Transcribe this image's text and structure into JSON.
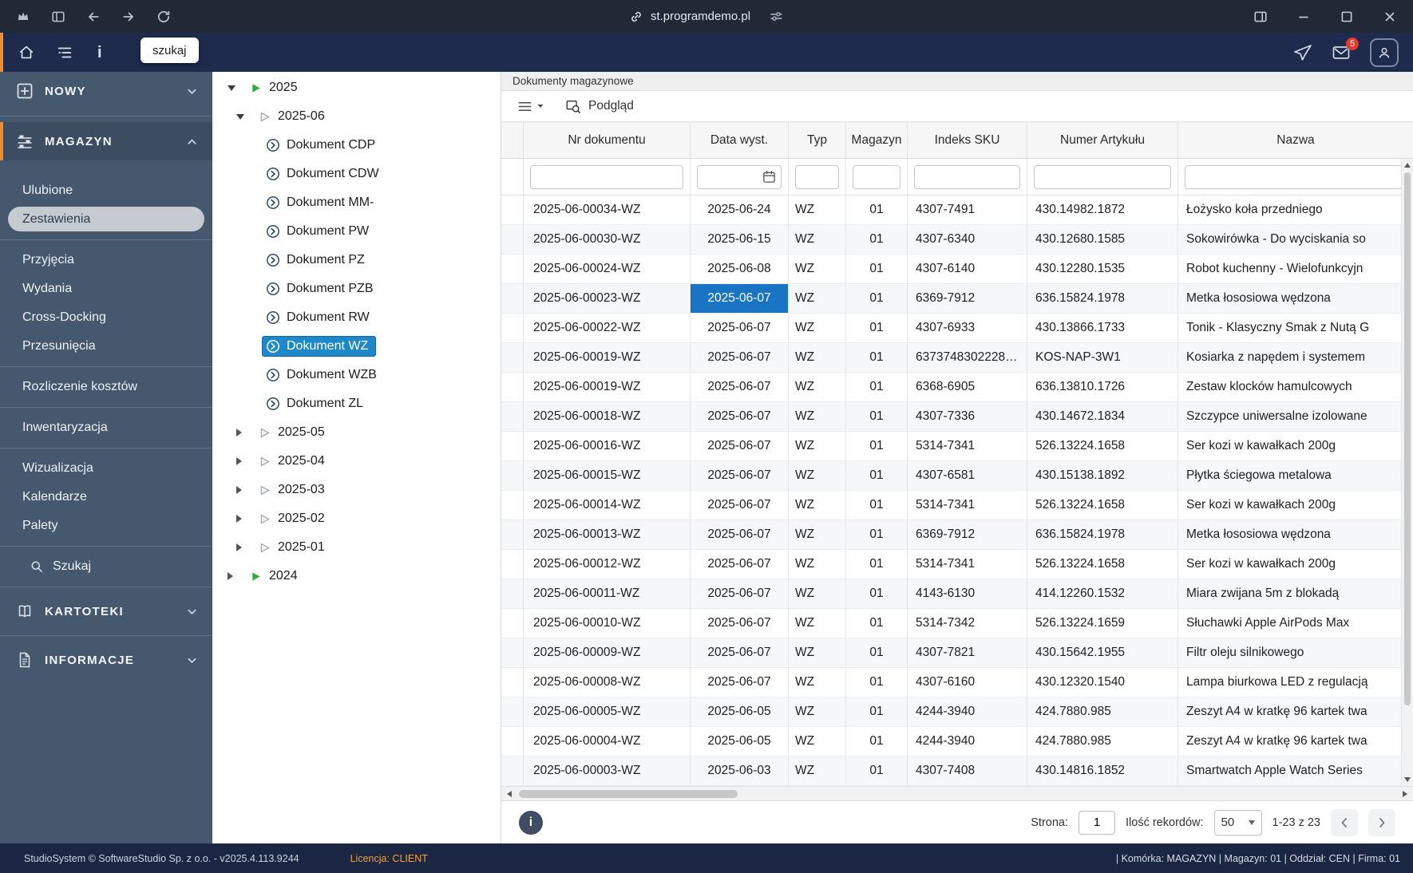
{
  "browser": {
    "url": "st.programdemo.pl"
  },
  "app_header": {
    "search_tooltip": "szukaj",
    "mail_badge": "5"
  },
  "sidebar": {
    "sections": [
      {
        "label": "NOWY",
        "state": "collapsed"
      },
      {
        "label": "MAGAZYN",
        "state": "expanded"
      },
      {
        "label": "KARTOTEKI",
        "state": "collapsed"
      },
      {
        "label": "INFORMACJE",
        "state": "collapsed"
      }
    ],
    "magazyn_items": [
      {
        "label": "Ulubione"
      },
      {
        "label": "Zestawienia",
        "selected": true
      },
      {
        "label": "Przyjęcia",
        "divider_before": true
      },
      {
        "label": "Wydania"
      },
      {
        "label": "Cross-Docking"
      },
      {
        "label": "Przesunięcia"
      },
      {
        "label": "Rozliczenie kosztów",
        "divider_before": true
      },
      {
        "label": "Inwentaryzacja",
        "divider_before": true
      },
      {
        "label": "Wizualizacja",
        "divider_before": true
      },
      {
        "label": "Kalendarze"
      },
      {
        "label": "Palety"
      },
      {
        "label": "Szukaj",
        "icon": "search",
        "divider_before": true
      }
    ]
  },
  "tree": {
    "items": [
      {
        "label": "2025",
        "level": 0,
        "icon": "year",
        "expanded": true
      },
      {
        "label": "2025-06",
        "level": 1,
        "icon": "month",
        "expanded": true
      },
      {
        "label": "Dokument CDP",
        "level": 2,
        "icon": "doc"
      },
      {
        "label": "Dokument CDW",
        "level": 2,
        "icon": "doc"
      },
      {
        "label": "Dokument MM-",
        "level": 2,
        "icon": "doc"
      },
      {
        "label": "Dokument PW",
        "level": 2,
        "icon": "doc"
      },
      {
        "label": "Dokument PZ",
        "level": 2,
        "icon": "doc"
      },
      {
        "label": "Dokument PZB",
        "level": 2,
        "icon": "doc"
      },
      {
        "label": "Dokument RW",
        "level": 2,
        "icon": "doc"
      },
      {
        "label": "Dokument WZ",
        "level": 2,
        "icon": "doc",
        "selected": true
      },
      {
        "label": "Dokument WZB",
        "level": 2,
        "icon": "doc"
      },
      {
        "label": "Dokument ZL",
        "level": 2,
        "icon": "doc"
      },
      {
        "label": "2025-05",
        "level": 1,
        "icon": "month",
        "expanded": false
      },
      {
        "label": "2025-04",
        "level": 1,
        "icon": "month",
        "expanded": false
      },
      {
        "label": "2025-03",
        "level": 1,
        "icon": "month",
        "expanded": false
      },
      {
        "label": "2025-02",
        "level": 1,
        "icon": "month",
        "expanded": false
      },
      {
        "label": "2025-01",
        "level": 1,
        "icon": "month",
        "expanded": false
      },
      {
        "label": "2024",
        "level": 0,
        "icon": "year",
        "expanded": false
      }
    ]
  },
  "main": {
    "title": "Dokumenty magazynowe",
    "toolbar": {
      "preview_label": "Podgląd"
    },
    "table": {
      "columns": [
        "Nr dokumentu",
        "Data wyst.",
        "Typ",
        "Magazyn",
        "Indeks SKU",
        "Numer Artykułu",
        "Nazwa"
      ],
      "filter_values": [
        "",
        "",
        "",
        "",
        "",
        "",
        ""
      ],
      "selected_cell": {
        "row_index": 3,
        "col_index": 1
      },
      "rows": [
        [
          "2025-06-00034-WZ",
          "2025-06-24",
          "WZ",
          "01",
          "4307-7491",
          "430.14982.1872",
          "Łożysko koła przedniego"
        ],
        [
          "2025-06-00030-WZ",
          "2025-06-15",
          "WZ",
          "01",
          "4307-6340",
          "430.12680.1585",
          "Sokowirówka - Do wyciskania so"
        ],
        [
          "2025-06-00024-WZ",
          "2025-06-08",
          "WZ",
          "01",
          "4307-6140",
          "430.12280.1535",
          "Robot kuchenny - Wielofunkcyjn"
        ],
        [
          "2025-06-00023-WZ",
          "2025-06-07",
          "WZ",
          "01",
          "6369-7912",
          "636.15824.1978",
          "Metka łososiowa wędzona"
        ],
        [
          "2025-06-00022-WZ",
          "2025-06-07",
          "WZ",
          "01",
          "4307-6933",
          "430.13866.1733",
          "Tonik - Klasyczny Smak z Nutą G"
        ],
        [
          "2025-06-00019-WZ",
          "2025-06-07",
          "WZ",
          "01",
          "6373748302228…",
          "KOS-NAP-3W1",
          "Kosiarka z napędem i systemem"
        ],
        [
          "2025-06-00019-WZ",
          "2025-06-07",
          "WZ",
          "01",
          "6368-6905",
          "636.13810.1726",
          "Zestaw klocków hamulcowych"
        ],
        [
          "2025-06-00018-WZ",
          "2025-06-07",
          "WZ",
          "01",
          "4307-7336",
          "430.14672.1834",
          "Szczypce uniwersalne izolowane"
        ],
        [
          "2025-06-00016-WZ",
          "2025-06-07",
          "WZ",
          "01",
          "5314-7341",
          "526.13224.1658",
          "Ser kozi w kawałkach 200g"
        ],
        [
          "2025-06-00015-WZ",
          "2025-06-07",
          "WZ",
          "01",
          "4307-6581",
          "430.15138.1892",
          "Płytka ściegowa metalowa"
        ],
        [
          "2025-06-00014-WZ",
          "2025-06-07",
          "WZ",
          "01",
          "5314-7341",
          "526.13224.1658",
          "Ser kozi w kawałkach 200g"
        ],
        [
          "2025-06-00013-WZ",
          "2025-06-07",
          "WZ",
          "01",
          "6369-7912",
          "636.15824.1978",
          "Metka łososiowa wędzona"
        ],
        [
          "2025-06-00012-WZ",
          "2025-06-07",
          "WZ",
          "01",
          "5314-7341",
          "526.13224.1658",
          "Ser kozi w kawałkach 200g"
        ],
        [
          "2025-06-00011-WZ",
          "2025-06-07",
          "WZ",
          "01",
          "4143-6130",
          "414.12260.1532",
          "Miara zwijana 5m z blokadą"
        ],
        [
          "2025-06-00010-WZ",
          "2025-06-07",
          "WZ",
          "01",
          "5314-7342",
          "526.13224.1659",
          "Słuchawki Apple AirPods Max"
        ],
        [
          "2025-06-00009-WZ",
          "2025-06-07",
          "WZ",
          "01",
          "4307-7821",
          "430.15642.1955",
          "Filtr oleju silnikowego"
        ],
        [
          "2025-06-00008-WZ",
          "2025-06-07",
          "WZ",
          "01",
          "4307-6160",
          "430.12320.1540",
          "Lampa biurkowa LED z regulacją"
        ],
        [
          "2025-06-00005-WZ",
          "2025-06-05",
          "WZ",
          "01",
          "4244-3940",
          "424.7880.985",
          "Zeszyt A4 w kratkę 96 kartek twa"
        ],
        [
          "2025-06-00004-WZ",
          "2025-06-05",
          "WZ",
          "01",
          "4244-3940",
          "424.7880.985",
          "Zeszyt A4 w kratkę 96 kartek twa"
        ],
        [
          "2025-06-00003-WZ",
          "2025-06-03",
          "WZ",
          "01",
          "4307-7408",
          "430.14816.1852",
          "Smartwatch Apple Watch Series"
        ]
      ]
    },
    "footer": {
      "page_label": "Strona:",
      "page_value": "1",
      "records_label": "Ilość rekordów:",
      "records_value": "50",
      "range_text": "1-23 z 23"
    }
  },
  "status_bar": {
    "left_text": "StudioSystem © SoftwareStudio Sp. z o.o. - v2025.4.113.9244",
    "license_text": "Licencja: CLIENT",
    "right_text": "| Komórka: MAGAZYN | Magazyn: 01 | Oddział: CEN | Firma: 01"
  },
  "colors": {
    "accent_orange": "#ef8d2f",
    "selection_blue": "#1a74c4",
    "tree_selection_blue": "#1e88c8",
    "badge_red": "#e23b30",
    "sidebar_bg": "#46586d",
    "header_bg": "#1e2b4d"
  },
  "icons": [
    "app-logo-icon",
    "sidebar-toggle-icon",
    "back-arrow-icon",
    "forward-arrow-icon",
    "reload-icon",
    "link-icon",
    "tune-icon",
    "panel-toggle-icon",
    "minimize-icon",
    "maximize-icon",
    "close-icon",
    "home-icon",
    "nav-tree-icon",
    "info-icon",
    "send-icon",
    "mail-icon",
    "user-icon",
    "plus-square-icon",
    "warehouse-icon",
    "book-icon",
    "document-icon",
    "search-icon",
    "chevron-down-icon",
    "chevron-up-icon",
    "hamburger-icon",
    "caret-down-icon",
    "preview-icon",
    "calendar-icon",
    "info-circle-icon",
    "year-node-icon",
    "month-node-icon",
    "document-node-icon"
  ]
}
